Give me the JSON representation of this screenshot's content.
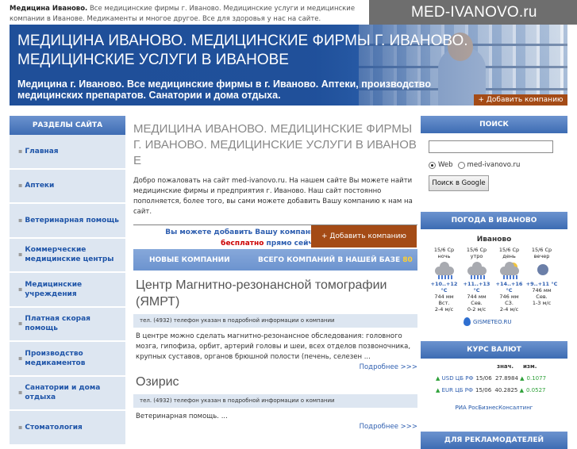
{
  "top": {
    "bold": "Медицина Иваново.",
    "text": "Все медицинские фирмы г. Иваново. Медицинские услуги и медицинские компании в Иванове. Медикаменты и многое другое. Все для здоровья у нас на сайте."
  },
  "logo": "MED-IVANOVO.ru",
  "banner": {
    "title": "МЕДИЦИНА ИВАНОВО. МЕДИЦИНСКИЕ ФИРМЫ Г. ИВАНОВО. МЕДИЦИНСКИЕ УСЛУГИ В ИВАНОВЕ",
    "subtitle": "Медицина г. Иваново. Все медицинские фирмы в г. Иваново. Аптеки, производство медицинских препаратов. Санатории и дома отдыха.",
    "add_button": "+ Добавить компанию"
  },
  "sidebar": {
    "title": "РАЗДЕЛЫ САЙТА",
    "items": [
      {
        "label": "Главная"
      },
      {
        "label": "Аптеки"
      },
      {
        "label": "Ветеринарная помощь"
      },
      {
        "label": "Коммерческие медицинские центры"
      },
      {
        "label": "Медицинские учреждения"
      },
      {
        "label": "Платная скорая помощь"
      },
      {
        "label": "Производство медикаментов"
      },
      {
        "label": "Санатории и дома отдыха"
      },
      {
        "label": "Стоматология"
      }
    ]
  },
  "main": {
    "title": "МЕДИЦИНА ИВАНОВО. МЕДИЦИНСКИЕ ФИРМЫ Г. ИВАНОВО. МЕДИЦИНСКИЕ УСЛУГИ В ИВАНОВЕ",
    "intro": "Добро пожаловать на сайт med-ivanovo.ru. На нашем сайте Вы можете найти медицинские фирмы и предприятия г. Иваново. Наш сайт постоянно пополняется, более того, вы сами можете добавить Вашу компанию к нам на сайт.",
    "add_text_1": "Вы можете добавить Вашу компанию",
    "add_text_red": "бесплатно",
    "add_text_2": "прямо сейчас",
    "add_button": "+ Добавить компанию",
    "tab_new": "НОВЫЕ КОМПАНИИ",
    "tab_total": "ВСЕГО КОМПАНИЙ В НАШЕЙ БАЗЕ",
    "total_count": "80",
    "companies": [
      {
        "title": "Центр Магнитно-резонансной томографии (ЯМРТ)",
        "phone": "тел. (4932) телефон указан в подробной информации о компании",
        "desc": "В центре можно сделать магнитно-резонансное обследования: головного мозга, гипофиза, орбит, артерий головы и шеи, всех отделов позвоночника, крупных суставов, органов брюшной полости (печень, селезен ...",
        "more": "Подробнее >>>"
      },
      {
        "title": "Озирис",
        "phone": "тел. (4932) телефон указан в подробной информации о компании",
        "desc": "Ветеринарная помощь. ...",
        "more": "Подробнее >>>"
      }
    ]
  },
  "search": {
    "title": "ПОИСК",
    "input_value": "",
    "option_web": "Web",
    "option_site": "med-ivanovo.ru",
    "button": "Поиск в Google"
  },
  "weather": {
    "title": "ПОГОДА В ИВАНОВО",
    "city": "Иваново",
    "forecasts": [
      {
        "date": "15/6 Ср",
        "part": "ночь",
        "icon": "cloud-rain-icon",
        "temp": "+10..+12 °C",
        "pressure": "744 мм",
        "wind": "Вст.",
        "speed": "2-4 м/с"
      },
      {
        "date": "15/6 Ср",
        "part": "утро",
        "icon": "cloud-rain-icon",
        "temp": "+11..+13 °C",
        "pressure": "744 мм",
        "wind": "Сев.",
        "speed": "0-2 м/с"
      },
      {
        "date": "15/6 Ср",
        "part": "день",
        "icon": "sun-cloud-rain-icon",
        "temp": "+14..+16 °C",
        "pressure": "746 мм",
        "wind": "СЗ.",
        "speed": "2-4 м/с"
      },
      {
        "date": "15/6 Ср",
        "part": "вечер",
        "icon": "moon-icon",
        "temp": "+9..+11 °C",
        "pressure": "746 мм",
        "wind": "Сев.",
        "speed": "1-3 м/с"
      }
    ],
    "source": "GISMETEO.RU"
  },
  "rates": {
    "title": "КУРС ВАЛЮТ",
    "col_value": "знач.",
    "col_change": "изм.",
    "rows": [
      {
        "name": "USD ЦБ РФ",
        "date": "15/06",
        "value": "27.8984",
        "change": "0.1077"
      },
      {
        "name": "EUR ЦБ РФ",
        "date": "15/06",
        "value": "40.2825",
        "change": "0.0527"
      }
    ],
    "source": "РИА РосБизнесКонсалтинг"
  },
  "ads": {
    "title": "ДЛЯ РЕКЛАМОДАТЕЛЕЙ"
  }
}
